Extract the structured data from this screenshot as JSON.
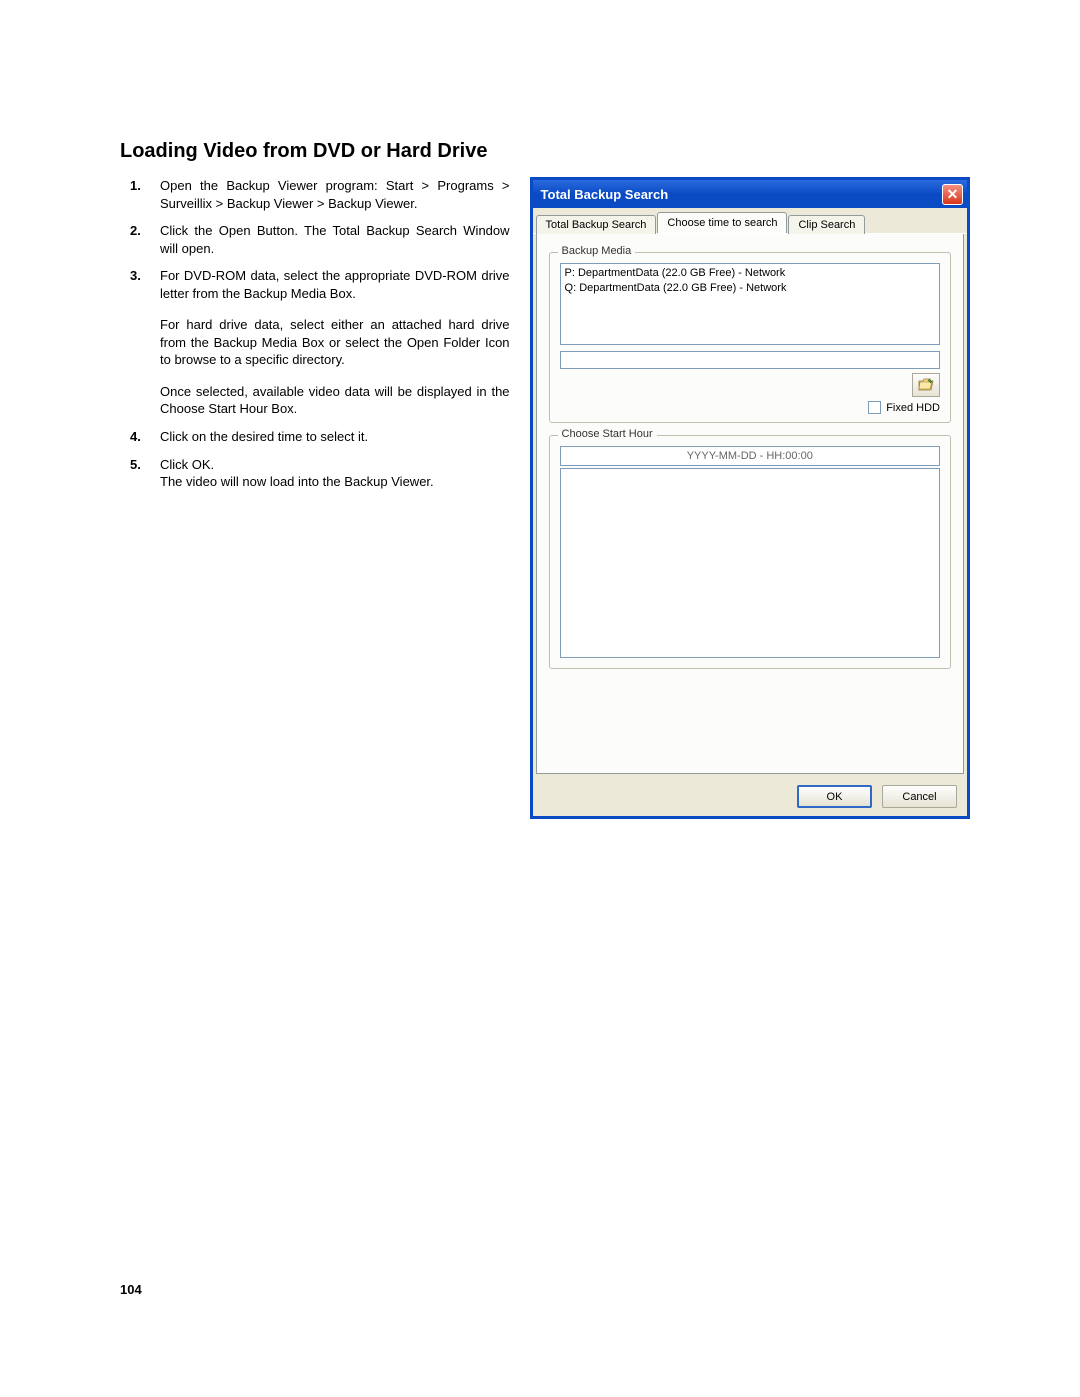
{
  "section_title": "Loading Video from DVD or Hard Drive",
  "page_number": "104",
  "steps": [
    {
      "num": "1.",
      "text": "Open the Backup Viewer program: Start > Programs > Surveillix > Backup Viewer > Backup Viewer."
    },
    {
      "num": "2.",
      "text": "Click the Open Button. The Total Backup Search Window will open."
    },
    {
      "num": "3.",
      "text": "For DVD-ROM data, select the appropriate DVD-ROM drive letter from the Backup Media Box.",
      "sub": [
        "For hard drive data, select either an attached hard drive from the Backup Media Box or select the Open Folder Icon to browse to a specific directory.",
        "Once selected, available video data will be displayed in the Choose Start Hour Box."
      ]
    },
    {
      "num": "4.",
      "text": "Click on the desired time to select it."
    },
    {
      "num": "5.",
      "text": "Click OK.",
      "sub": [
        "The video will now load into the Backup Viewer."
      ]
    }
  ],
  "dialog": {
    "title": "Total Backup Search",
    "tabs": [
      "Total Backup Search",
      "Choose time to search",
      "Clip Search"
    ],
    "active_tab": 1,
    "backup_media": {
      "legend": "Backup Media",
      "items": [
        "P:  DepartmentData (22.0 GB Free) - Network",
        "Q:  DepartmentData (22.0 GB Free) - Network"
      ],
      "fixed_hdd_label": "Fixed HDD"
    },
    "choose_start": {
      "legend": "Choose Start Hour",
      "placeholder": "YYYY-MM-DD - HH:00:00"
    },
    "buttons": {
      "ok": "OK",
      "cancel": "Cancel"
    }
  }
}
